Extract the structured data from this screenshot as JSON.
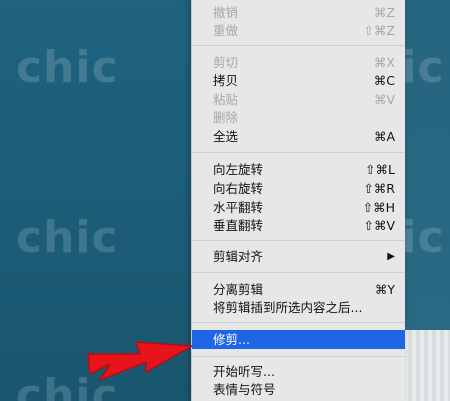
{
  "watermark": "chic",
  "menu": {
    "items": [
      {
        "label": "撤销",
        "shortcut": "⌘Z",
        "disabled": true
      },
      {
        "label": "重做",
        "shortcut": "⇧⌘Z",
        "disabled": true
      },
      {
        "label": "剪切",
        "shortcut": "⌘X",
        "disabled": true
      },
      {
        "label": "拷贝",
        "shortcut": "⌘C",
        "disabled": false
      },
      {
        "label": "粘贴",
        "shortcut": "⌘V",
        "disabled": true
      },
      {
        "label": "删除",
        "shortcut": "",
        "disabled": true
      },
      {
        "label": "全选",
        "shortcut": "⌘A",
        "disabled": false
      },
      {
        "label": "向左旋转",
        "shortcut": "⇧⌘L",
        "disabled": false
      },
      {
        "label": "向右旋转",
        "shortcut": "⇧⌘R",
        "disabled": false
      },
      {
        "label": "水平翻转",
        "shortcut": "⇧⌘H",
        "disabled": false
      },
      {
        "label": "垂直翻转",
        "shortcut": "⇧⌘V",
        "disabled": false
      },
      {
        "label": "剪辑对齐",
        "shortcut": "▶",
        "disabled": false
      },
      {
        "label": "分离剪辑",
        "shortcut": "⌘Y",
        "disabled": false
      },
      {
        "label": "将剪辑插到所选内容之后...",
        "shortcut": "",
        "disabled": false
      },
      {
        "label": "修剪...",
        "shortcut": "",
        "disabled": false,
        "highlighted": true
      },
      {
        "label": "开始听写...",
        "shortcut": "",
        "disabled": false
      },
      {
        "label": "表情与符号",
        "shortcut": "",
        "disabled": false
      }
    ]
  },
  "colors": {
    "highlight": "#1f66e6",
    "background": "#1d5e78",
    "annotation_arrow": "#e8141b"
  }
}
